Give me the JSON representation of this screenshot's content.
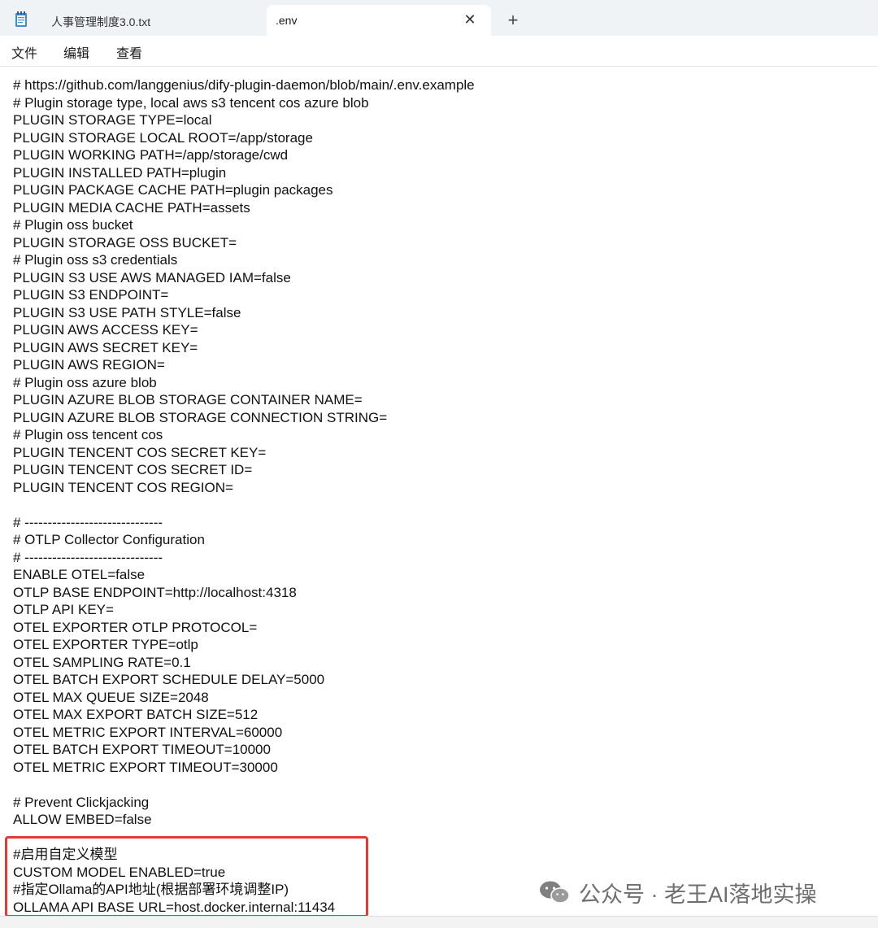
{
  "tabs": [
    {
      "title": "人事管理制度3.0.txt",
      "active": false
    },
    {
      "title": ".env",
      "active": true
    }
  ],
  "menu": [
    "文件",
    "编辑",
    "查看"
  ],
  "editor_lines": [
    "# https://github.com/langgenius/dify-plugin-daemon/blob/main/.env.example",
    "# Plugin storage type, local aws s3 tencent cos azure blob",
    "PLUGIN STORAGE TYPE=local",
    "PLUGIN STORAGE LOCAL ROOT=/app/storage",
    "PLUGIN WORKING PATH=/app/storage/cwd",
    "PLUGIN INSTALLED PATH=plugin",
    "PLUGIN PACKAGE CACHE PATH=plugin packages",
    "PLUGIN MEDIA CACHE PATH=assets",
    "# Plugin oss bucket",
    "PLUGIN STORAGE OSS BUCKET=",
    "# Plugin oss s3 credentials",
    "PLUGIN S3 USE AWS MANAGED IAM=false",
    "PLUGIN S3 ENDPOINT=",
    "PLUGIN S3 USE PATH STYLE=false",
    "PLUGIN AWS ACCESS KEY=",
    "PLUGIN AWS SECRET KEY=",
    "PLUGIN AWS REGION=",
    "# Plugin oss azure blob",
    "PLUGIN AZURE BLOB STORAGE CONTAINER NAME=",
    "PLUGIN AZURE BLOB STORAGE CONNECTION STRING=",
    "# Plugin oss tencent cos",
    "PLUGIN TENCENT COS SECRET KEY=",
    "PLUGIN TENCENT COS SECRET ID=",
    "PLUGIN TENCENT COS REGION=",
    "",
    "# ------------------------------",
    "# OTLP Collector Configuration",
    "# ------------------------------",
    "ENABLE OTEL=false",
    "OTLP BASE ENDPOINT=http://localhost:4318",
    "OTLP API KEY=",
    "OTEL EXPORTER OTLP PROTOCOL=",
    "OTEL EXPORTER TYPE=otlp",
    "OTEL SAMPLING RATE=0.1",
    "OTEL BATCH EXPORT SCHEDULE DELAY=5000",
    "OTEL MAX QUEUE SIZE=2048",
    "OTEL MAX EXPORT BATCH SIZE=512",
    "OTEL METRIC EXPORT INTERVAL=60000",
    "OTEL BATCH EXPORT TIMEOUT=10000",
    "OTEL METRIC EXPORT TIMEOUT=30000",
    "",
    "# Prevent Clickjacking",
    "ALLOW EMBED=false",
    "",
    "#启用自定义模型",
    "CUSTOM MODEL ENABLED=true",
    "#指定Ollama的API地址(根据部署环境调整IP)",
    "OLLAMA API BASE URL=host.docker.internal:11434"
  ],
  "highlight_color": "#e53935",
  "watermark": {
    "text": "公众号 · 老王AI落地实操",
    "icon": "wechat-icon"
  }
}
